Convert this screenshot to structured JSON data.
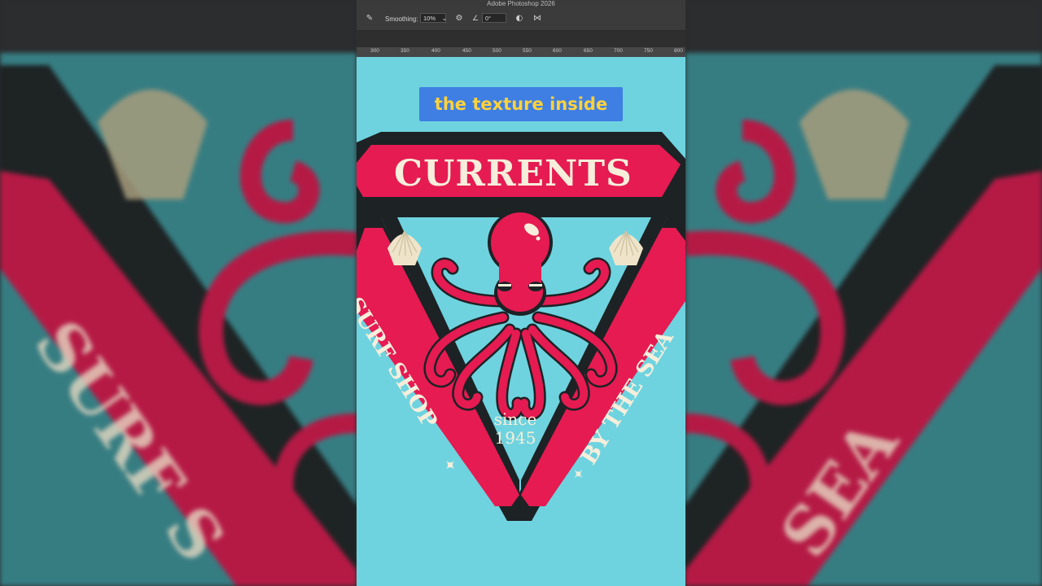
{
  "window": {
    "title": "Adobe Photoshop 2026"
  },
  "options_bar": {
    "smoothing_label": "Smoothing:",
    "smoothing_value": "10%",
    "angle_value": "0°",
    "tool_icon": "brush-icon",
    "settings_icon": "gear-icon",
    "angle_icon": "angle-icon",
    "pressure_icon": "pressure-icon",
    "symmetry_icon": "butterfly-icon"
  },
  "ruler": {
    "ticks": [
      "300",
      "350",
      "400",
      "450",
      "500",
      "550",
      "600",
      "650",
      "700",
      "750",
      "800"
    ]
  },
  "caption": {
    "text": "the texture inside"
  },
  "artwork": {
    "brand": "CURRENTS",
    "left_banner": "SURF SHOP",
    "right_banner": "BY THE SEA",
    "since_line1": "since",
    "since_line2": "1945",
    "colors": {
      "background": "#6ed3df",
      "pink": "#e51b52",
      "dark": "#1d2225",
      "cream": "#f6eedb"
    }
  }
}
